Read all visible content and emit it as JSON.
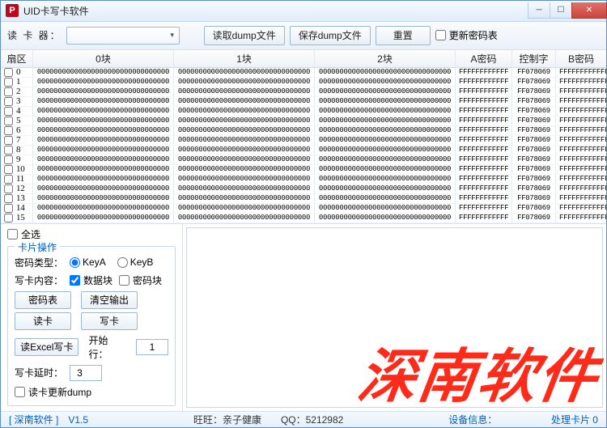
{
  "window": {
    "title": "UID卡写卡软件"
  },
  "toolbar": {
    "reader_label": "读 卡 器：",
    "read_dump": "读取dump文件",
    "save_dump": "保存dump文件",
    "reset": "重置",
    "update_keys": "更新密码表"
  },
  "table": {
    "headers": {
      "sector": "扇区",
      "b0": "0块",
      "b1": "1块",
      "b2": "2块",
      "keya": "A密码",
      "ctrl": "控制字",
      "keyb": "B密码"
    },
    "row_defaults": {
      "block": "00000000000000000000000000000000",
      "keya": "FFFFFFFFFFFF",
      "ctrl": "FF078069",
      "keyb": "FFFFFFFFFFFF"
    },
    "count": 16
  },
  "left": {
    "select_all": "全选",
    "card_ops": "卡片操作",
    "key_type_label": "密码类型：",
    "key_a": "KeyA",
    "key_b": "KeyB",
    "write_content_label": "写卡内容：",
    "data_block": "数据块",
    "key_block": "密码块",
    "key_table_btn": "密码表",
    "clear_output_btn": "清空输出",
    "read_card_btn": "读卡",
    "write_card_btn": "写卡",
    "read_excel_btn": "读Excel写卡",
    "start_row_label": "开始行：",
    "start_row_value": "1",
    "write_delay_label": "写卡延时：",
    "write_delay_value": "3",
    "update_dump_chk": "读卡更新dump"
  },
  "status": {
    "left": "[ 深南软件 ]　V1.5",
    "mid": "旺旺：亲子健康　　QQ：5212982",
    "right_label": "设备信息：",
    "right2_label": "处理卡片",
    "right2_value": "0"
  },
  "watermark": "深南软件"
}
